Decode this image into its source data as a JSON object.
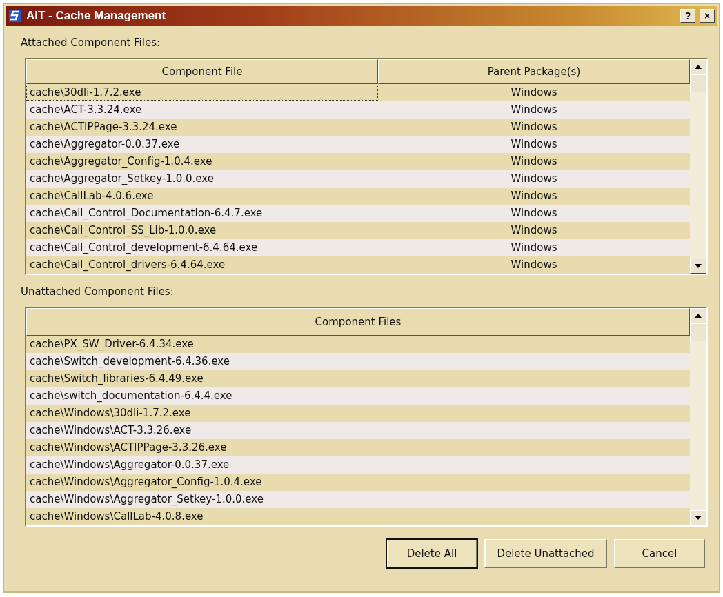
{
  "window": {
    "title": "AIT - Cache Management",
    "help_button": "?",
    "close_button": "×"
  },
  "attached": {
    "label": "Attached Component Files:",
    "columns": [
      "Component File",
      "Parent Package(s)"
    ],
    "rows": [
      {
        "file": "cache\\30dli-1.7.2.exe",
        "package": "Windows",
        "focused": true
      },
      {
        "file": "cache\\ACT-3.3.24.exe",
        "package": "Windows",
        "focused": false
      },
      {
        "file": "cache\\ACTIPPage-3.3.24.exe",
        "package": "Windows",
        "focused": false
      },
      {
        "file": "cache\\Aggregator-0.0.37.exe",
        "package": "Windows",
        "focused": false
      },
      {
        "file": "cache\\Aggregator_Config-1.0.4.exe",
        "package": "Windows",
        "focused": false
      },
      {
        "file": "cache\\Aggregator_Setkey-1.0.0.exe",
        "package": "Windows",
        "focused": false
      },
      {
        "file": "cache\\CallLab-4.0.6.exe",
        "package": "Windows",
        "focused": false
      },
      {
        "file": "cache\\Call_Control_Documentation-6.4.7.exe",
        "package": "Windows",
        "focused": false
      },
      {
        "file": "cache\\Call_Control_SS_Lib-1.0.0.exe",
        "package": "Windows",
        "focused": false
      },
      {
        "file": "cache\\Call_Control_development-6.4.64.exe",
        "package": "Windows",
        "focused": false
      },
      {
        "file": "cache\\Call_Control_drivers-6.4.64.exe",
        "package": "Windows",
        "focused": false
      }
    ]
  },
  "unattached": {
    "label": "Unattached Component Files:",
    "columns": [
      "Component Files"
    ],
    "rows": [
      "cache\\PX_SW_Driver-6.4.34.exe",
      "cache\\Switch_development-6.4.36.exe",
      "cache\\Switch_libraries-6.4.49.exe",
      "cache\\switch_documentation-6.4.4.exe",
      "cache\\Windows\\30dli-1.7.2.exe",
      "cache\\Windows\\ACT-3.3.26.exe",
      "cache\\Windows\\ACTIPPage-3.3.26.exe",
      "cache\\Windows\\Aggregator-0.0.37.exe",
      "cache\\Windows\\Aggregator_Config-1.0.4.exe",
      "cache\\Windows\\Aggregator_Setkey-1.0.0.exe",
      "cache\\Windows\\CallLab-4.0.8.exe"
    ]
  },
  "buttons": [
    {
      "label": "Delete All",
      "default": true
    },
    {
      "label": "Delete Unattached",
      "default": false
    },
    {
      "label": "Cancel",
      "default": false
    }
  ]
}
